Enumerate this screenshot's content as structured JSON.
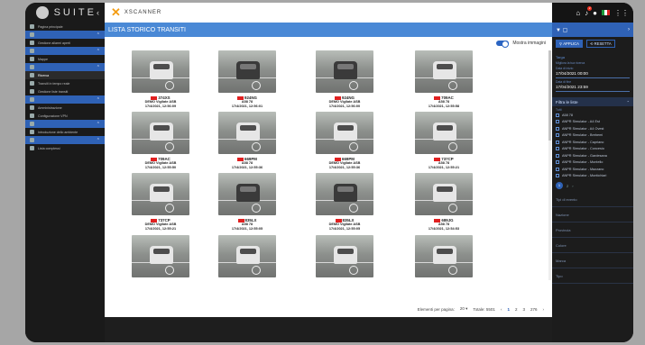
{
  "brand": {
    "logo_text": "SUITE",
    "collapse_icon": "chevron-left-icon"
  },
  "app": {
    "logo_mark": "✕",
    "name": "XSCANNER"
  },
  "page": {
    "title": "LISTA STORICO TRANSITI",
    "toggle_label": "Mostra immagini",
    "toggle_on": true
  },
  "sidebar": {
    "items": [
      {
        "label": "Pagina principale",
        "type": "item",
        "icon": "home-icon"
      },
      {
        "label": "",
        "type": "section",
        "icon": "user-icon"
      },
      {
        "label": "Gestione allarmi aperti",
        "type": "item",
        "icon": "bell-icon"
      },
      {
        "label": "",
        "type": "section",
        "icon": "map-icon"
      },
      {
        "label": "Mappe",
        "type": "item",
        "icon": "map-icon"
      },
      {
        "label": "",
        "type": "section",
        "icon": "search-icon"
      },
      {
        "label": "Ricerca",
        "type": "active",
        "icon": "car-icon"
      },
      {
        "label": "Transiti in tempo reale",
        "type": "item",
        "icon": "clock-icon"
      },
      {
        "label": "Gestione liste transiti",
        "type": "item",
        "icon": "list-icon"
      },
      {
        "label": "",
        "type": "section",
        "icon": "settings-icon"
      },
      {
        "label": "Amministrazione",
        "type": "item",
        "icon": "settings-icon"
      },
      {
        "label": "Configurazione VPN",
        "type": "item",
        "icon": "vpn-icon"
      },
      {
        "label": "",
        "type": "section",
        "icon": "chart-icon"
      },
      {
        "label": "Introduzione dello ambiente",
        "type": "item",
        "icon": "info-icon"
      },
      {
        "label": "",
        "type": "section",
        "icon": "user-icon"
      },
      {
        "label": "Lista complessi",
        "type": "item",
        "icon": "list-icon"
      }
    ]
  },
  "transits": [
    {
      "plate": "374XS",
      "line1": "DEMO Vigilate ASB",
      "line2": "17/4/2021, 12:56:09",
      "dark": false
    },
    {
      "plate": "924NG",
      "line1": "A58 78",
      "line2": "17/4/2021, 12:56:01",
      "dark": true
    },
    {
      "plate": "924NG",
      "line1": "DEMO Vigilate ASB",
      "line2": "17/4/2021, 12:56:00",
      "dark": true
    },
    {
      "plate": "709AC",
      "line1": "A58 78",
      "line2": "17/4/2021, 12:55:58",
      "dark": false
    },
    {
      "plate": "709AC",
      "line1": "DEMO Vigilate ASB",
      "line2": "17/4/2021, 12:55:50",
      "dark": false
    },
    {
      "plate": "669PM",
      "line1": "A58 78",
      "line2": "17/4/2021, 12:55:36",
      "dark": false
    },
    {
      "plate": "669PM",
      "line1": "DEMO Vigilate ASB",
      "line2": "17/4/2021, 12:55:36",
      "dark": false
    },
    {
      "plate": "737CP",
      "line1": "A58 78",
      "line2": "17/4/2021, 12:55:21",
      "dark": false
    },
    {
      "plate": "737CP",
      "line1": "DEMO Vigilate ASB",
      "line2": "17/4/2021, 12:55:21",
      "dark": false
    },
    {
      "plate": "835LX",
      "line1": "A58 78",
      "line2": "17/4/2021, 12:55:05",
      "dark": true
    },
    {
      "plate": "835LX",
      "line1": "DEMO Vigilate ASB",
      "line2": "17/4/2021, 12:55:05",
      "dark": true
    },
    {
      "plate": "689JG",
      "line1": "A58 78",
      "line2": "17/4/2021, 12:54:53",
      "dark": false
    },
    {
      "plate": "",
      "line1": "",
      "line2": "",
      "dark": false
    },
    {
      "plate": "",
      "line1": "",
      "line2": "",
      "dark": false
    },
    {
      "plate": "",
      "line1": "",
      "line2": "",
      "dark": false
    },
    {
      "plate": "",
      "line1": "",
      "line2": "",
      "dark": false
    }
  ],
  "pager": {
    "per_page_label": "Elementi per pagina:",
    "per_page": "20",
    "total": "Totale: 5501",
    "pages": [
      "1",
      "2",
      "3"
    ],
    "last_page": "276",
    "prev": "‹",
    "next": "›"
  },
  "right_panel": {
    "filter_title": "",
    "apply_label": "APPLICA",
    "reset_label": "RESETTA",
    "section_target": "Targa",
    "target_hint": "Migliora la tua ricerca",
    "date_from_label": "Data di inizio",
    "date_from": "17/04/2021 00:00",
    "date_to_label": "Data di fine",
    "date_to": "17/04/2021 23:59",
    "list_header": "Filtra le liste",
    "list_sub": "Tutti",
    "cameras": [
      "A58 78",
      "ANPR Simulator - A4 Est",
      "ANPR Simulator - A4 Ovest",
      "ANPR Simulator - Brebemi",
      "ANPR Simulator - Capriano",
      "ANPR Simulator - Concesio",
      "ANPR Simulator - Gardesana",
      "ANPR Simulator - Montello",
      "ANPR Simulator - Mazzano",
      "ANPR Simulator - Montichiari"
    ],
    "cam_page": "1",
    "cam_page_next": "2",
    "fields": [
      "Tipi di evento",
      "Nazione",
      "Provincia",
      "Colore",
      "Marca",
      "Tipo"
    ]
  }
}
